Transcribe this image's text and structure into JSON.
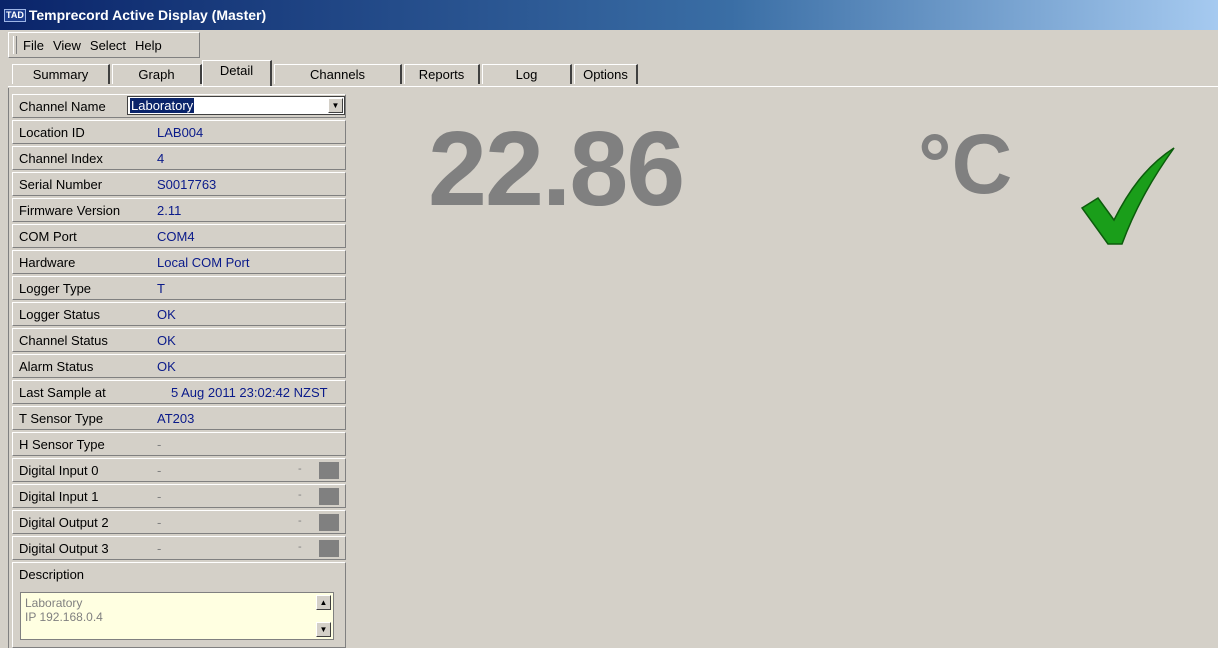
{
  "window": {
    "logo": "TAD",
    "title": "Temprecord Active Display (Master)"
  },
  "menu": [
    "File",
    "View",
    "Select",
    "Help"
  ],
  "tabs": [
    "Summary",
    "Graph",
    "Detail",
    "Channels",
    "Reports",
    "Log",
    "Options"
  ],
  "active_tab": "Detail",
  "channel_name": {
    "label": "Channel Name",
    "value": "Laboratory"
  },
  "fields": [
    {
      "label": "Location ID",
      "value": "LAB004"
    },
    {
      "label": "Channel Index",
      "value": "4"
    },
    {
      "label": "Serial Number",
      "value": "S0017763"
    },
    {
      "label": "Firmware Version",
      "value": " 2.11"
    },
    {
      "label": "COM Port",
      "value": "COM4"
    },
    {
      "label": "Hardware",
      "value": "Local COM Port"
    },
    {
      "label": "Logger Type",
      "value": "T"
    },
    {
      "label": "Logger Status",
      "value": "OK"
    },
    {
      "label": "Channel Status",
      "value": "OK"
    },
    {
      "label": "Alarm Status",
      "value": "OK"
    },
    {
      "label": "Last Sample at",
      "value": "5 Aug 2011 23:02:42 NZST"
    },
    {
      "label": "T Sensor Type",
      "value": " AT203"
    },
    {
      "label": "H Sensor Type",
      "value": "-"
    }
  ],
  "digital": [
    {
      "label": "Digital Input 0",
      "value": "-",
      "state": "-"
    },
    {
      "label": "Digital Input 1",
      "value": "-",
      "state": "-"
    },
    {
      "label": "Digital Output 2",
      "value": "-",
      "state": "-"
    },
    {
      "label": "Digital Output 3",
      "value": "-",
      "state": "-"
    }
  ],
  "description": {
    "label": "Description",
    "lines": [
      "Laboratory",
      "IP 192.168.0.4"
    ]
  },
  "reading": {
    "value": "22.86",
    "unit": "°C",
    "status_icon": "check-icon",
    "status_color": "#1a9e1a"
  }
}
